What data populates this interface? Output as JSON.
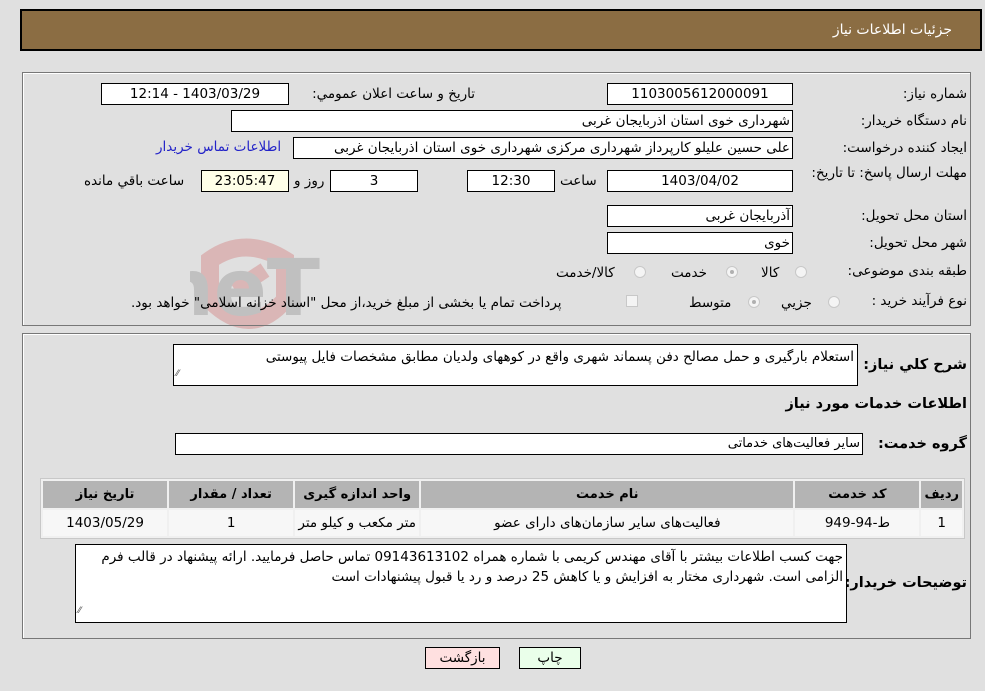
{
  "header": {
    "title": "جزئیات اطلاعات نیاز"
  },
  "details": {
    "need_number": {
      "label": "شماره نیاز:",
      "value": "1103005612000091"
    },
    "announce_datetime": {
      "label": "تاریخ و ساعت اعلان عمومي:",
      "value": "1403/03/29 - 12:14"
    },
    "buyer_org": {
      "label": "نام دستگاه خريدار:",
      "value": "شهرداری خوی استان اذربایجان غربی"
    },
    "requester": {
      "label": "ایجاد کننده درخواست:",
      "value": "علی حسین علیلو کارپرداز شهرداری مرکزی شهرداری خوی استان اذربایجان غربی"
    },
    "buyer_contact_link": "اطلاعات تماس خریدار",
    "deadline": {
      "label": "مهلت ارسال پاسخ: تا تاریخ:",
      "date": "1403/04/02",
      "time_label": "ساعت",
      "time": "12:30",
      "days": "3",
      "days_label": "روز و",
      "remaining_time": "23:05:47",
      "remaining_label": "ساعت باقي مانده"
    },
    "delivery_province": {
      "label": "استان محل تحویل:",
      "value": "آذربایجان غربی"
    },
    "delivery_city": {
      "label": "شهر محل تحویل:",
      "value": "خوی"
    },
    "category": {
      "label": "طبقه بندی موضوعی:",
      "options": [
        "کالا",
        "خدمت",
        "کالا/خدمت"
      ],
      "selected": "خدمت"
    },
    "purchase_type": {
      "label": "نوع فرآيند خريد :",
      "options": [
        "جزيي",
        "متوسط"
      ],
      "selected": "متوسط",
      "treasury_checkbox_label": "پرداخت تمام يا بخشی از مبلغ خريد،از محل \"اسناد خزانه اسلامی\" خواهد بود.",
      "treasury_checked": false
    }
  },
  "description": {
    "label": "شرح کلي نياز:",
    "value": "استعلام بارگیری و حمل مصالح دفن پسماند شهری واقع در کوههای ولدیان مطابق مشخصات فایل پیوستی"
  },
  "services_section": {
    "title": "اطلاعات خدمات مورد نياز",
    "group_label": "گروه خدمت:",
    "group_value": "سایر فعالیت‌های خدماتی",
    "table": {
      "headers": [
        "رديف",
        "کد خدمت",
        "نام خدمت",
        "واحد اندازه گيری",
        "تعداد / مقدار",
        "تاريخ نياز"
      ],
      "rows": [
        [
          "1",
          "ط-94-949",
          "فعالیت‌های سایر سازمان‌های دارای عضو",
          "متر مکعب و کیلو متر",
          "1",
          "1403/05/29"
        ]
      ]
    }
  },
  "buyer_notes": {
    "label": "توضيحات خريدار:",
    "value": "جهت کسب اطلاعات بیشتر با آقای مهندس کریمی با شماره همراه 09143613102 تماس حاصل فرمایید. ارائه پیشنهاد در قالب فرم الزامی است. شهرداری مختار به افزایش و یا کاهش 25 درصد و رد یا قبول پیشنهادات است"
  },
  "buttons": {
    "print": "چاپ",
    "back": "بازگشت"
  },
  "colors": {
    "header_bg": "#8b6d43",
    "print_bg": "#eaffea",
    "back_bg": "#ffe0e0",
    "link": "#2323c8"
  }
}
